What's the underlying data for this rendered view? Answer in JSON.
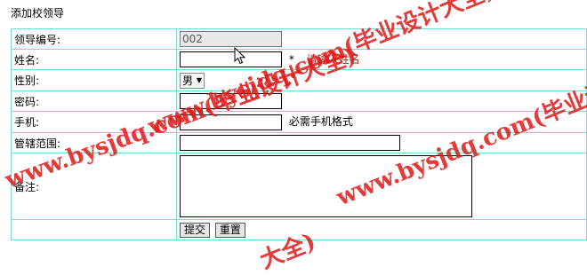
{
  "page": {
    "heading": "添加校领导"
  },
  "form": {
    "leader_id": {
      "label": "领导编号:",
      "value": "002"
    },
    "name": {
      "label": "姓名:",
      "value": "",
      "required_mark": "*",
      "hint": "请输入姓名"
    },
    "gender": {
      "label": "性别:",
      "selected": "男"
    },
    "password": {
      "label": "密码:",
      "value": ""
    },
    "phone": {
      "label": "手机:",
      "value": "",
      "hint": "必需手机格式"
    },
    "scope": {
      "label": "管辖范围:",
      "value": ""
    },
    "remarks": {
      "label": "备注:",
      "value": ""
    },
    "submit_label": "提交",
    "reset_label": "重置"
  },
  "watermarks": [
    "www.bysjdq.com(毕业设计大全)",
    "www.bysjdq.com(毕业设计大全)",
    "www.bysjdq.com(毕业设计大全)",
    "大全)"
  ],
  "colors": {
    "table_border": "#7fd7d7",
    "hint_red": "#c01010",
    "watermark_red": "#e01818"
  }
}
